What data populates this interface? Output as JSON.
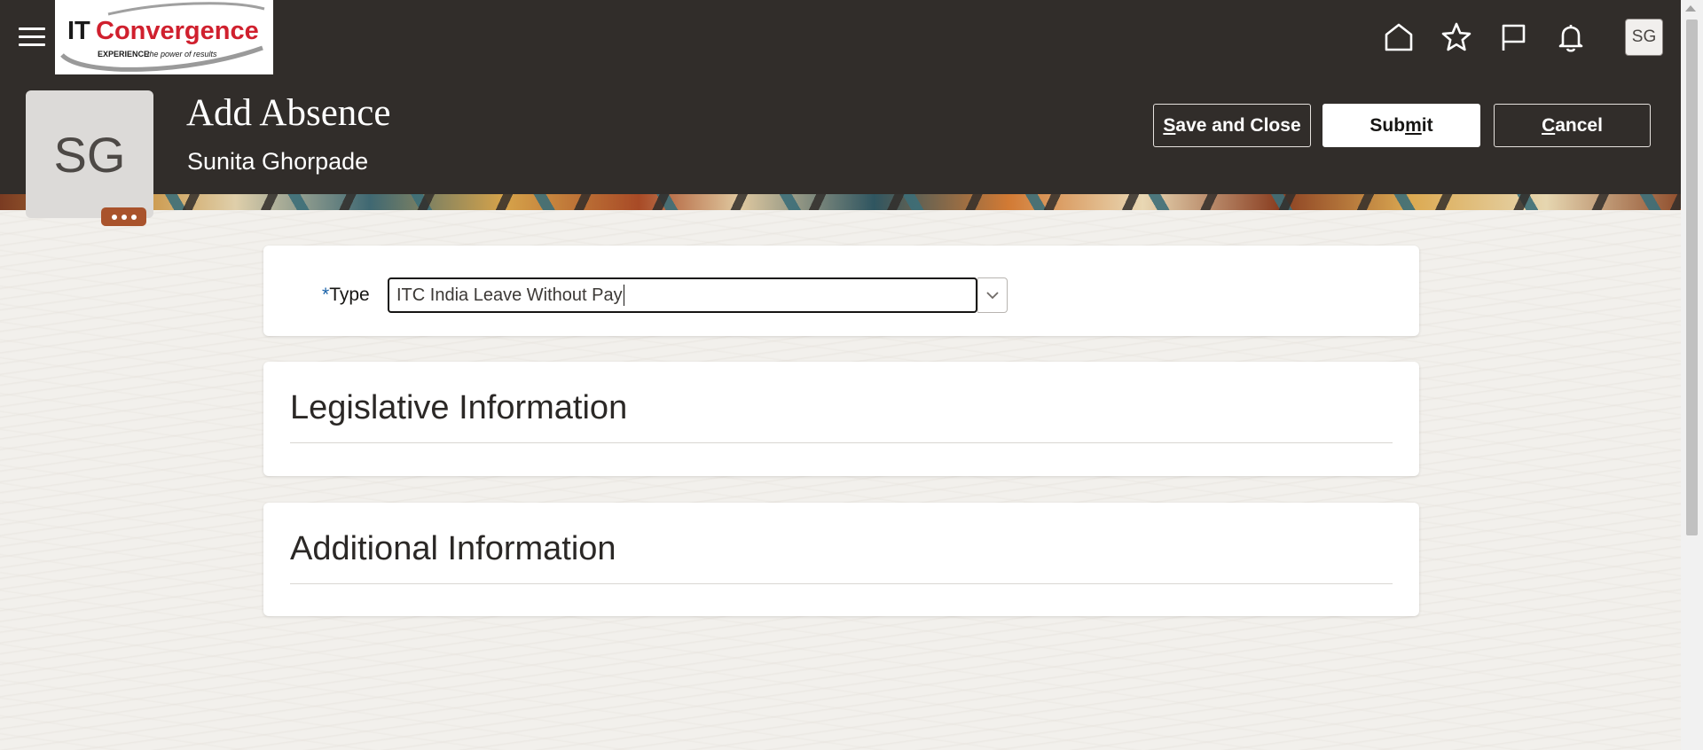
{
  "header": {
    "menu_icon": "hamburger-menu-icon",
    "logo_alt": "ITConvergence",
    "logo_brand_it": "IT",
    "logo_brand_rest": "Convergence",
    "logo_tagline_bold": "EXPERIENCE",
    "logo_tagline": "the power of results",
    "icons": [
      "home-icon",
      "favorites-star-icon",
      "flag-icon",
      "notifications-bell-icon"
    ],
    "user_initials": "SG"
  },
  "page": {
    "title": "Add Absence",
    "person_name": "Sunita Ghorpade",
    "avatar_initials": "SG"
  },
  "actions": {
    "save_and_close": {
      "pre": "",
      "mnemonic": "S",
      "post": "ave and Close"
    },
    "submit": {
      "pre": "Sub",
      "mnemonic": "m",
      "post": "it"
    },
    "cancel": {
      "pre": "",
      "mnemonic": "C",
      "post": "ancel"
    }
  },
  "form": {
    "type_required_marker": "*",
    "type_label": "Type",
    "type_value": "ITC India Leave Without Pay"
  },
  "sections": {
    "legislative": "Legislative Information",
    "additional": "Additional Information"
  },
  "colors": {
    "header_bg": "#312d2a",
    "more_button": "#a9532c",
    "required_marker": "#1a62a8",
    "logo_red": "#d0202e"
  }
}
